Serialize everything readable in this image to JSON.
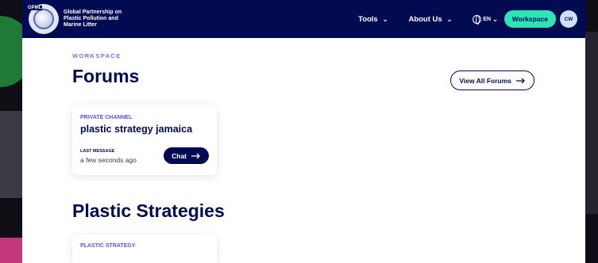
{
  "logo": {
    "tag": "GPML",
    "text": "Global Partnership on Plastic Pollution and Marine Litter"
  },
  "nav": {
    "tools": "Tools",
    "about": "About Us",
    "lang": "EN",
    "workspace": "Workspace",
    "avatar": "CW"
  },
  "page": {
    "eyebrow": "WORKSPACE",
    "title": "Forums",
    "view_all": "View All Forums"
  },
  "forum_card": {
    "tag": "PRIVATE CHANNEL",
    "title": "plastic strategy jamaica",
    "meta_label": "LAST MESSAGE",
    "meta_value": "a few seconds ago",
    "chat": "Chat"
  },
  "strategies": {
    "title": "Plastic Strategies",
    "card_tag": "PLASTIC STRATEGY"
  },
  "colors": {
    "navy": "#020a52",
    "accent": "#2ee3b5",
    "purple": "#7b6cf0"
  },
  "icons": [
    "globe-icon",
    "chevron-down-icon",
    "arrow-right-icon"
  ]
}
